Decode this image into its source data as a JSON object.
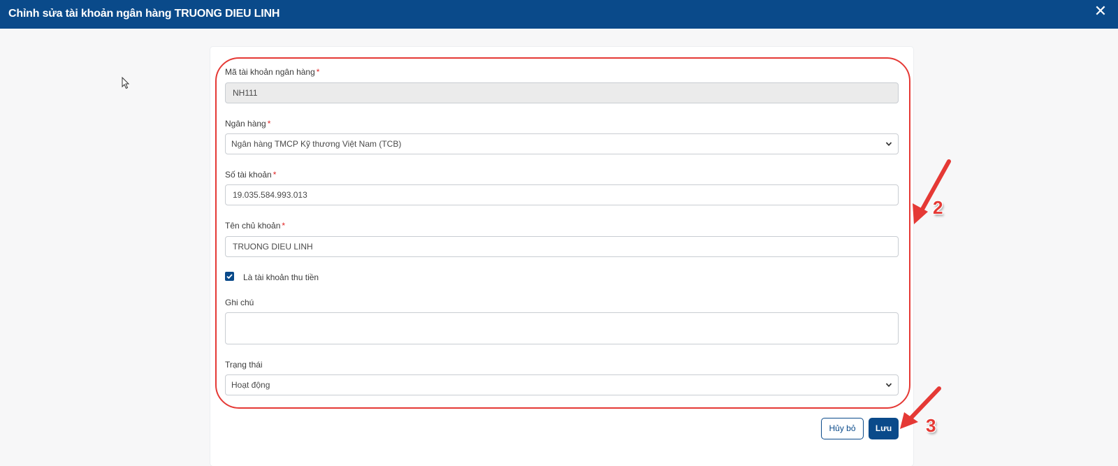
{
  "header": {
    "title": "Chỉnh sửa tài khoản ngân hàng TRUONG DIEU LINH",
    "close_icon": "close-icon"
  },
  "form": {
    "account_code": {
      "label": "Mã tài khoản ngân hàng",
      "required_mark": "*",
      "value": "NH111"
    },
    "bank": {
      "label": "Ngân hàng",
      "required_mark": "*",
      "selected": "Ngân hàng TMCP Kỹ thương Việt Nam (TCB)"
    },
    "account_number": {
      "label": "Số tài khoản",
      "required_mark": "*",
      "value": "19.035.584.993.013"
    },
    "account_holder": {
      "label": "Tên chủ khoản",
      "required_mark": "*",
      "value": "TRUONG DIEU LINH"
    },
    "is_collection_account": {
      "label": "Là tài khoản thu tiền",
      "checked": true
    },
    "note": {
      "label": "Ghi chú",
      "value": ""
    },
    "status": {
      "label": "Trạng thái",
      "selected": "Hoạt động"
    }
  },
  "actions": {
    "cancel_label": "Hủy bỏ",
    "save_label": "Lưu"
  },
  "annotations": {
    "step_2": "2",
    "step_3": "3",
    "color": "#e53935"
  },
  "colors": {
    "primary": "#0a4a8a",
    "required": "#e02424"
  }
}
